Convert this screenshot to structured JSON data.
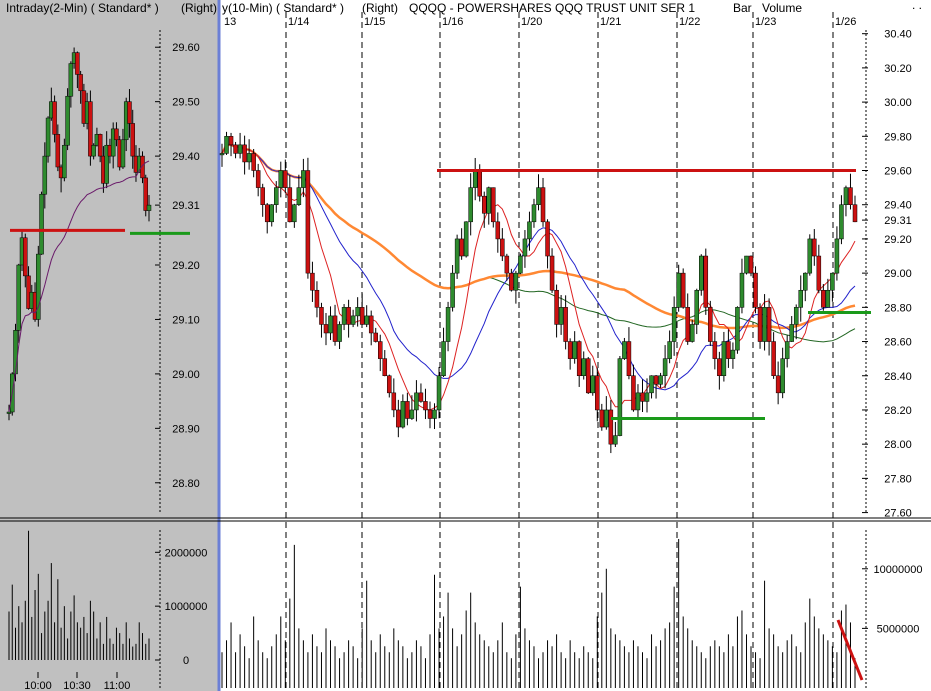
{
  "window": {
    "left_title": "Intraday(2-Min) ( Standard* )",
    "left_scale": "(Right)",
    "right_period": "y(10-Min) ( Standard* )",
    "right_scale": "(Right)",
    "symbol_title": "QQQQ - POWERSHARES QQQ TRUST UNIT SER 1",
    "chart_style": "Bar",
    "volume_label": "Volume",
    "corner_mark": ". ."
  },
  "colors": {
    "left_bg": "#c0c0c0",
    "right_bg": "#ffffff",
    "bull": "#2e8b2e",
    "bear": "#cc1111",
    "divider": "#6b7fd6",
    "resistance": "#cc1111",
    "support": "#1a9a1a",
    "ma_fast": "#dd2222",
    "ma_mid": "#2222cc",
    "ma_slow": "#226622",
    "ma_long": "#ff8833",
    "vwap": "#6a1a6a"
  },
  "chart_data": [
    {
      "name": "intraday",
      "type": "candlestick",
      "interval": "2-Min",
      "y_ticks": [
        "29.60",
        "29.50",
        "29.40",
        "29.31",
        "29.20",
        "29.10",
        "29.00",
        "28.90",
        "28.80"
      ],
      "last_price": "29.31",
      "ylim": [
        28.75,
        29.65
      ],
      "x_ticks": [
        "10:00",
        "10:30",
        "11:00"
      ],
      "close": [
        28.93,
        29.0,
        29.08,
        29.2,
        29.25,
        29.18,
        29.12,
        29.15,
        29.1,
        29.22,
        29.33,
        29.4,
        29.47,
        29.5,
        29.44,
        29.38,
        29.36,
        29.42,
        29.51,
        29.57,
        29.59,
        29.55,
        29.52,
        29.46,
        29.5,
        29.4,
        29.42,
        29.44,
        29.4,
        29.35,
        29.42,
        29.4,
        29.45,
        29.43,
        29.38,
        29.43,
        29.5,
        29.46,
        29.4,
        29.37,
        29.4,
        29.36,
        29.3,
        29.31
      ],
      "resistance_level": 29.26,
      "support_level": 29.26,
      "volume": {
        "y_ticks": [
          "2000000",
          "1000000",
          "0"
        ],
        "values": [
          900000,
          1400000,
          600000,
          1000000,
          700000,
          1100000,
          2400000,
          800000,
          1300000,
          1600000,
          500000,
          900000,
          1100000,
          1800000,
          700000,
          1500000,
          600000,
          1000000,
          400000,
          900000,
          1200000,
          700000,
          600000,
          800000,
          500000,
          1100000,
          900000,
          400000,
          700000,
          300000,
          800000,
          400000,
          300000,
          600000,
          500000,
          300000,
          700000,
          400000,
          250000,
          300000,
          700000,
          500000,
          300000,
          400000
        ]
      }
    },
    {
      "name": "multiday",
      "type": "candlestick",
      "interval": "10-Min",
      "date_labels": [
        "13",
        "1/14",
        "1/15",
        "1/16",
        "1/20",
        "1/21",
        "1/22",
        "1/23",
        "1/26"
      ],
      "y_ticks": [
        "30.40",
        "30.20",
        "30.00",
        "29.80",
        "29.60",
        "29.40",
        "29.31",
        "29.20",
        "29.00",
        "28.80",
        "28.60",
        "28.40",
        "28.20",
        "28.00",
        "27.80",
        "27.60"
      ],
      "last_price": "29.31",
      "ylim": [
        27.58,
        30.48
      ],
      "close": [
        29.7,
        29.8,
        29.75,
        29.7,
        29.75,
        29.65,
        29.7,
        29.6,
        29.5,
        29.4,
        29.3,
        29.4,
        29.5,
        29.6,
        29.5,
        29.3,
        29.4,
        29.5,
        29.6,
        29.0,
        28.9,
        28.8,
        28.7,
        28.65,
        28.75,
        28.6,
        28.7,
        28.8,
        28.7,
        28.75,
        28.8,
        28.7,
        28.75,
        28.65,
        28.6,
        28.5,
        28.4,
        28.3,
        28.2,
        28.1,
        28.25,
        28.15,
        28.2,
        28.3,
        28.25,
        28.2,
        28.15,
        28.2,
        28.4,
        28.6,
        28.8,
        29.0,
        29.2,
        29.1,
        29.3,
        29.5,
        29.6,
        29.45,
        29.35,
        29.5,
        29.3,
        29.2,
        29.1,
        29.0,
        28.9,
        29.0,
        29.1,
        29.2,
        29.3,
        29.4,
        29.5,
        29.3,
        29.1,
        28.9,
        28.7,
        28.8,
        28.6,
        28.5,
        28.6,
        28.4,
        28.5,
        28.3,
        28.4,
        28.2,
        28.1,
        28.2,
        28.0,
        28.05,
        28.5,
        28.6,
        28.4,
        28.2,
        28.3,
        28.25,
        28.3,
        28.4,
        28.35,
        28.4,
        28.5,
        28.6,
        28.8,
        29.0,
        28.8,
        28.6,
        28.7,
        28.9,
        29.1,
        28.8,
        28.6,
        28.5,
        28.4,
        28.6,
        28.5,
        28.55,
        28.8,
        29.0,
        29.1,
        29.0,
        28.8,
        28.6,
        28.8,
        28.6,
        28.4,
        28.3,
        28.5,
        28.6,
        28.7,
        28.8,
        28.9,
        29.0,
        29.2,
        29.1,
        28.9,
        28.8,
        28.9,
        29.0,
        29.2,
        29.4,
        29.5,
        29.4,
        29.3
      ],
      "resistance_level": 29.6,
      "support_level_1": 28.15,
      "support_level_2": 28.77,
      "volume": {
        "y_ticks": [
          "10000000",
          "5000000"
        ],
        "values": [
          3000000,
          4000000,
          5500000,
          3000000,
          4500000,
          3500000,
          2500000,
          6000000,
          4000000,
          3000000,
          2500000,
          3500000,
          4500000,
          6000000,
          4000000,
          7500000,
          12000000,
          5000000,
          4000000,
          3000000,
          4500000,
          3500000,
          3000000,
          5000000,
          4000000,
          3500000,
          2500000,
          3000000,
          4000000,
          3500000,
          2500000,
          5000000,
          9000000,
          4000000,
          3000000,
          4500000,
          3500000,
          3000000,
          5000000,
          4000000,
          3500000,
          2500000,
          3000000,
          4000000,
          3500000,
          2500000,
          4500000,
          9500000,
          5000000,
          6000000,
          8000000,
          5000000,
          3500000,
          4500000,
          6500000,
          8000000,
          5500000,
          4500000,
          4000000,
          3500000,
          3000000,
          4000000,
          5500000,
          3000000,
          2500000,
          4500000,
          8500000,
          5000000,
          4000000,
          3500000,
          2500000,
          3000000,
          4000000,
          3500000,
          4500000,
          3000000,
          2500000,
          4000000,
          3000000,
          2500000,
          3500000,
          3000000,
          2500000,
          6000000,
          8000000,
          10000000,
          5000000,
          4500000,
          4000000,
          3500000,
          3000000,
          4000000,
          3500000,
          3000000,
          2500000,
          4500000,
          3500000,
          4000000,
          5000000,
          5500000,
          8500000,
          12500000,
          6000000,
          5000000,
          4000000,
          3500000,
          3000000,
          2500000,
          3500000,
          4000000,
          3500000,
          3000000,
          4500000,
          3500000,
          6000000,
          6500000,
          4500000,
          3500000,
          3000000,
          2500000,
          9000000,
          5000000,
          4500000,
          3500000,
          3000000,
          4000000,
          4500000,
          3500000,
          3000000,
          5500000,
          7500000,
          6000000,
          5000000,
          4500000,
          4000000,
          3500000,
          3000000,
          6500000,
          7000000,
          5500000,
          2500000
        ]
      }
    }
  ]
}
